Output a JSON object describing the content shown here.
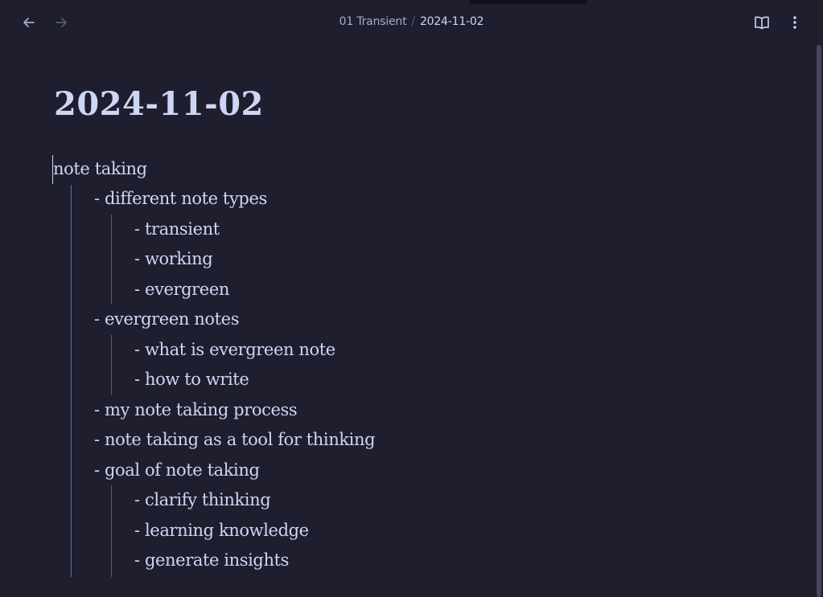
{
  "header": {
    "back_icon": "arrow-left-icon",
    "forward_icon": "arrow-right-icon",
    "breadcrumb": {
      "parent": "01 Transient",
      "separator": "/",
      "current": "2024-11-02"
    },
    "reading_view_icon": "book-open-icon",
    "more_options_icon": "more-vertical-icon"
  },
  "note": {
    "title": "2024-11-02",
    "root": "note taking",
    "items": [
      {
        "text": "- different note types"
      },
      {
        "text": "- transient"
      },
      {
        "text": "- working"
      },
      {
        "text": "- evergreen"
      },
      {
        "text": "- evergreen notes"
      },
      {
        "text": "- what is evergreen note"
      },
      {
        "text": "- how to write"
      },
      {
        "text": "- my note taking process"
      },
      {
        "text": "- note taking as a tool for thinking"
      },
      {
        "text": "- goal of note taking"
      },
      {
        "text": "- clarify thinking"
      },
      {
        "text": "- learning knowledge"
      },
      {
        "text": "- generate insights"
      }
    ]
  },
  "colors": {
    "background": "#1e1e2e",
    "text": "#cdd6f4",
    "muted": "#a6adc8",
    "indent_guide_l1": "#89b4fa",
    "indent_guide_l2": "#585b70"
  }
}
